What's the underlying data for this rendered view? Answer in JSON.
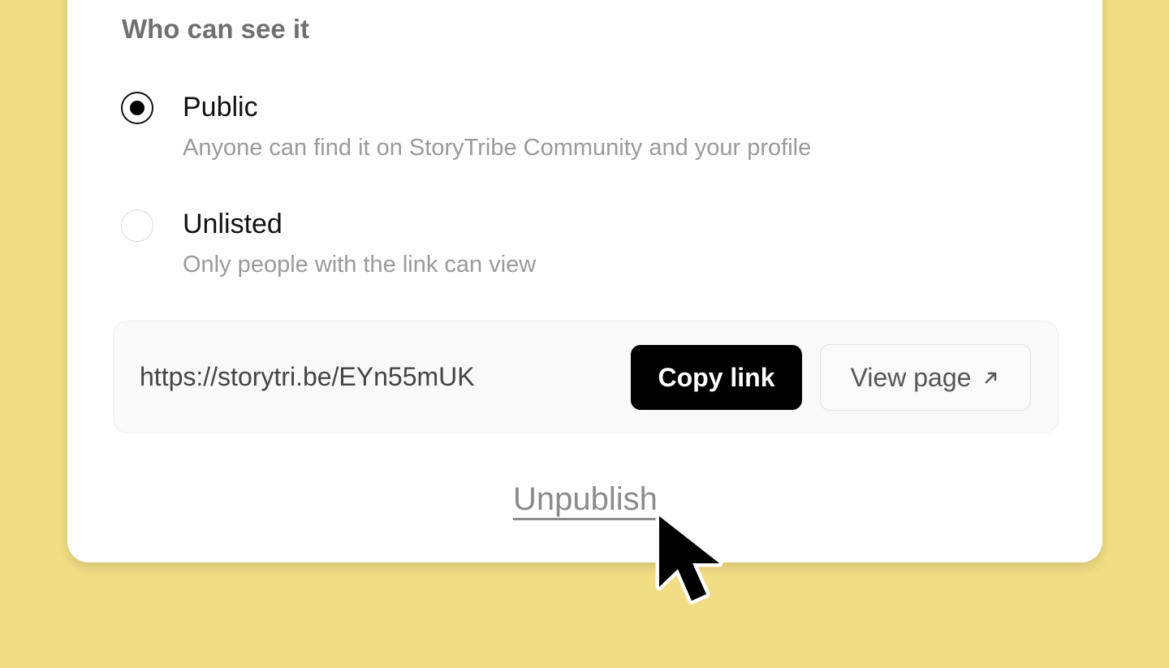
{
  "visibility": {
    "title": "Who can see it",
    "options": [
      {
        "label": "Public",
        "description": "Anyone can find it on StoryTribe Community and your profile",
        "selected": true
      },
      {
        "label": "Unlisted",
        "description": "Only people with the link can view",
        "selected": false
      }
    ]
  },
  "share": {
    "url": "https://storytri.be/EYn55mUK",
    "copy_label": "Copy link",
    "view_label": "View page",
    "view_icon": "arrow-up-right-icon"
  },
  "unpublish_label": "Unpublish",
  "colors": {
    "background": "#f1dd83",
    "card": "#ffffff",
    "primary_button": "#000000"
  }
}
